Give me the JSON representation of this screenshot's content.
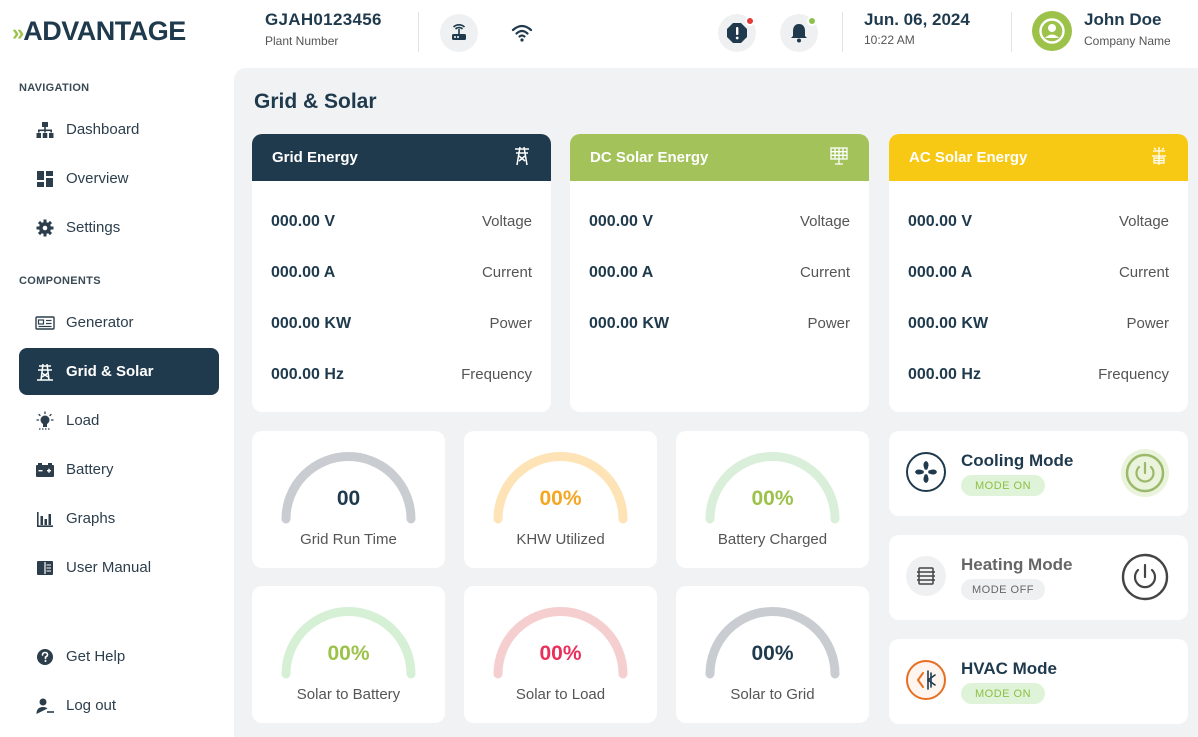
{
  "header": {
    "logo_chevrons": "»",
    "logo_text": "ADVANTAGE",
    "plant_number": "GJAH0123456",
    "plant_label": "Plant Number",
    "date": "Jun. 06, 2024",
    "time": "10:22 AM",
    "user_name": "John Doe",
    "company": "Company Name",
    "alert_dot_color": "#e53935",
    "bell_dot_color": "#8bc34a"
  },
  "sidebar": {
    "navigation_label": "NAVIGATION",
    "components_label": "COMPONENTS",
    "nav": [
      {
        "label": "Dashboard",
        "icon": "sitemap-icon"
      },
      {
        "label": "Overview",
        "icon": "grid-icon"
      },
      {
        "label": "Settings",
        "icon": "gear-icon"
      }
    ],
    "components": [
      {
        "label": "Generator",
        "icon": "generator-icon"
      },
      {
        "label": "Grid & Solar",
        "icon": "tower-icon",
        "active": true
      },
      {
        "label": "Load",
        "icon": "bulb-icon"
      },
      {
        "label": "Battery",
        "icon": "battery-icon"
      },
      {
        "label": "Graphs",
        "icon": "bar-chart-icon"
      },
      {
        "label": "User Manual",
        "icon": "book-icon"
      }
    ],
    "footer": [
      {
        "label": "Get Help",
        "icon": "help-icon"
      },
      {
        "label": "Log out",
        "icon": "logout-icon"
      }
    ]
  },
  "main": {
    "title": "Grid & Solar",
    "energy_cards": [
      {
        "title": "Grid Energy",
        "color": "#1f3a4d",
        "icon": "transmission-tower-icon",
        "rows": [
          {
            "value": "000.00 V",
            "label": "Voltage"
          },
          {
            "value": "000.00 A",
            "label": "Current"
          },
          {
            "value": "000.00 KW",
            "label": "Power"
          },
          {
            "value": "000.00 Hz",
            "label": "Frequency"
          }
        ]
      },
      {
        "title": "DC Solar Energy",
        "color": "#a3c35a",
        "icon": "solar-panel-icon",
        "rows": [
          {
            "value": "000.00 V",
            "label": "Voltage"
          },
          {
            "value": "000.00 A",
            "label": "Current"
          },
          {
            "value": "000.00 KW",
            "label": "Power"
          }
        ]
      },
      {
        "title": "AC Solar Energy",
        "color": "#f7c914",
        "icon": "solar-tower-icon",
        "rows": [
          {
            "value": "000.00 V",
            "label": "Voltage"
          },
          {
            "value": "000.00 A",
            "label": "Current"
          },
          {
            "value": "000.00 KW",
            "label": "Power"
          },
          {
            "value": "000.00 Hz",
            "label": "Frequency"
          }
        ]
      }
    ],
    "gauges": [
      {
        "value": "00",
        "label": "Grid Run Time",
        "arc_color": "#c9cdd1",
        "text_color": "#1f3a4d"
      },
      {
        "value": "00%",
        "label": "KHW Utilized",
        "arc_color": "#fde3b6",
        "text_color": "#f5a623"
      },
      {
        "value": "00%",
        "label": "Battery Charged",
        "arc_color": "#d9efd9",
        "text_color": "#9cc24a"
      },
      {
        "value": "00%",
        "label": "Solar to Battery",
        "arc_color": "#d6f0d6",
        "text_color": "#9cc24a"
      },
      {
        "value": "00%",
        "label": "Solar to Load",
        "arc_color": "#f5cfcf",
        "text_color": "#e8305b"
      },
      {
        "value": "00%",
        "label": "Solar to Grid",
        "arc_color": "#c9cdd1",
        "text_color": "#1f3a4d"
      }
    ],
    "modes": [
      {
        "title": "Cooling Mode",
        "status": "MODE ON",
        "icon": "fan-icon",
        "on": true,
        "has_power": true
      },
      {
        "title": "Heating Mode",
        "status": "MODE OFF",
        "icon": "heater-icon",
        "on": false,
        "has_power": true
      },
      {
        "title": "HVAC Mode",
        "status": "MODE ON",
        "icon": "hvac-icon",
        "on": true,
        "has_power": false
      }
    ]
  }
}
